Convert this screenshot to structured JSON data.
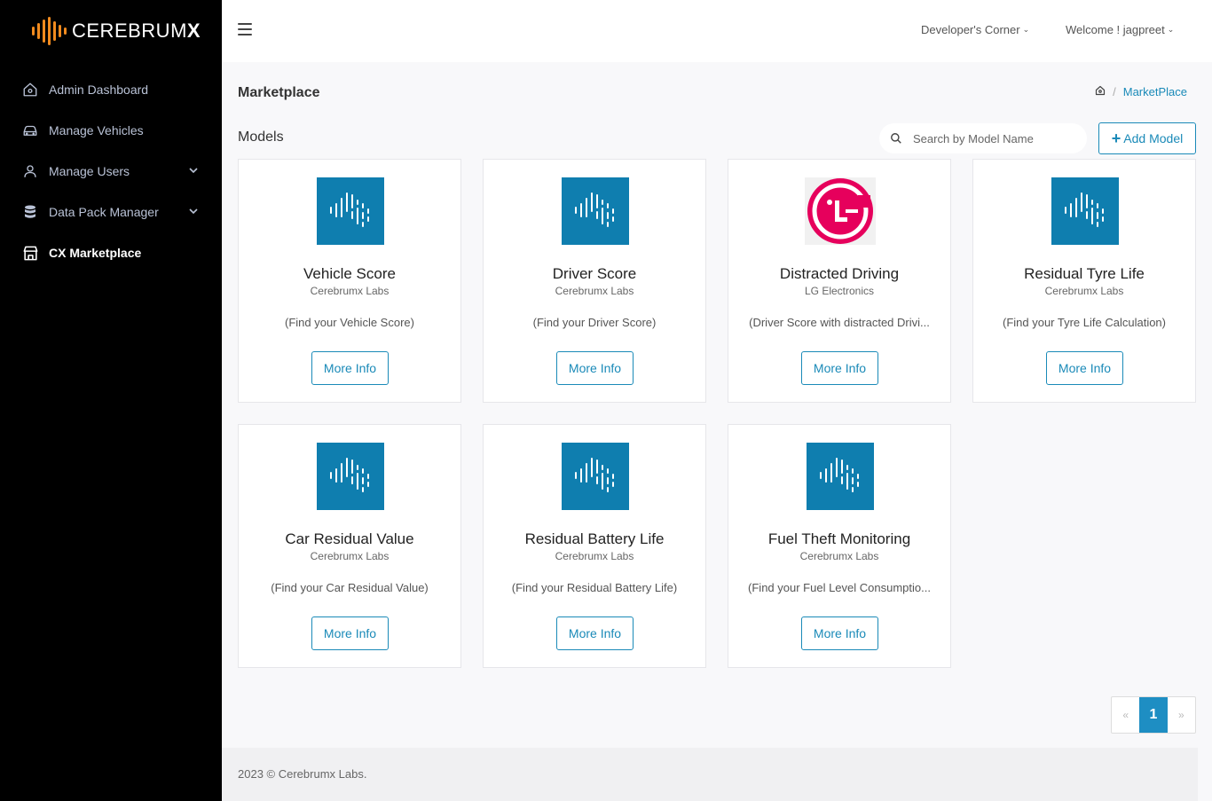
{
  "app": {
    "brand_light": "CEREBRUM",
    "brand_bold": "X"
  },
  "sidebar": {
    "items": [
      {
        "label": "Admin Dashboard",
        "icon": "home-icon",
        "active": false,
        "expandable": false
      },
      {
        "label": "Manage Vehicles",
        "icon": "car-icon",
        "active": false,
        "expandable": false
      },
      {
        "label": "Manage Users",
        "icon": "user-icon",
        "active": false,
        "expandable": true
      },
      {
        "label": "Data Pack Manager",
        "icon": "database-icon",
        "active": false,
        "expandable": true
      },
      {
        "label": "CX Marketplace",
        "icon": "store-icon",
        "active": true,
        "expandable": false
      }
    ]
  },
  "header": {
    "developers_corner": "Developer's Corner",
    "welcome": "Welcome ! jagpreet"
  },
  "page": {
    "title": "Marketplace",
    "breadcrumb_separator": "/",
    "breadcrumb_current": "MarketPlace",
    "section_title": "Models",
    "search_placeholder": "Search by Model Name",
    "add_button": "Add Model"
  },
  "models": [
    {
      "name": "Vehicle Score",
      "vendor": "Cerebrumx Labs",
      "description": "(Find your Vehicle Score)",
      "button": "More Info",
      "logo": "cerebrumx"
    },
    {
      "name": "Driver Score",
      "vendor": "Cerebrumx Labs",
      "description": "(Find your Driver Score)",
      "button": "More Info",
      "logo": "cerebrumx"
    },
    {
      "name": "Distracted Driving",
      "vendor": "LG Electronics",
      "description": "(Driver Score with distracted Drivi...",
      "button": "More Info",
      "logo": "lg"
    },
    {
      "name": "Residual Tyre Life",
      "vendor": "Cerebrumx Labs",
      "description": "(Find your Tyre Life Calculation)",
      "button": "More Info",
      "logo": "cerebrumx"
    },
    {
      "name": "Car Residual Value",
      "vendor": "Cerebrumx Labs",
      "description": "(Find your Car Residual Value)",
      "button": "More Info",
      "logo": "cerebrumx"
    },
    {
      "name": "Residual Battery Life",
      "vendor": "Cerebrumx Labs",
      "description": "(Find your Residual Battery Life)",
      "button": "More Info",
      "logo": "cerebrumx"
    },
    {
      "name": "Fuel Theft Monitoring",
      "vendor": "Cerebrumx Labs",
      "description": "(Find your Fuel Level Consumptio...",
      "button": "More Info",
      "logo": "cerebrumx"
    }
  ],
  "pagination": {
    "prev": "«",
    "current": "1",
    "next": "»"
  },
  "footer": {
    "text": "2023 © Cerebrumx Labs."
  },
  "colors": {
    "accent": "#1a8ab8",
    "brand_orange": "#f28b1e",
    "tile_blue": "#0f7eaf",
    "lg_red": "#e6005c"
  }
}
